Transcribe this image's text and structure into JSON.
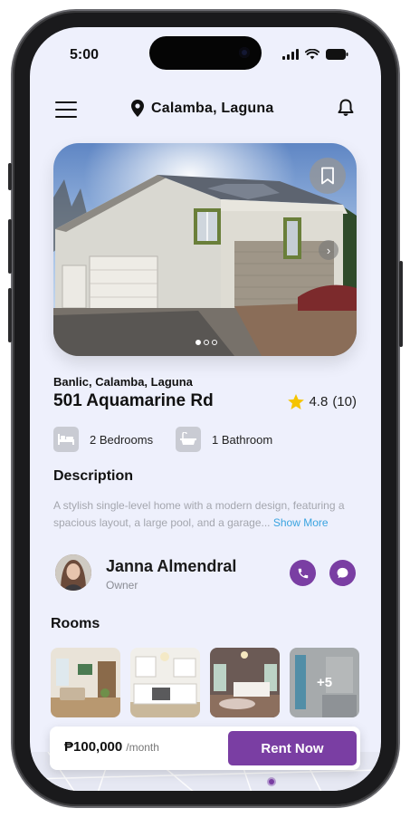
{
  "status_bar": {
    "time": "5:00"
  },
  "header": {
    "location": "Calamba, Laguna",
    "icons": [
      "menu-icon",
      "location-pin-icon",
      "bell-icon"
    ]
  },
  "listing": {
    "gallery": {
      "bookmark_icon": "bookmark-icon",
      "next_icon": "chevron-right-icon",
      "page_count": 3,
      "active_page": 1
    },
    "address_line": "Banlic, Calamba, Laguna",
    "street": "501 Aquamarine Rd",
    "rating": "4.8",
    "review_count": "(10)",
    "features": [
      {
        "icon": "bed-icon",
        "label": "2 Bedrooms"
      },
      {
        "icon": "bathtub-icon",
        "label": "1 Bathroom"
      }
    ]
  },
  "description": {
    "heading": "Description",
    "text": "A stylish single-level home with a modern design, featuring a spacious layout, a large pool, and a garage...",
    "more_label": "Show More"
  },
  "owner": {
    "name": "Janna Almendral",
    "role": "Owner",
    "call_icon": "phone-icon",
    "chat_icon": "chat-icon"
  },
  "rooms": {
    "heading": "Rooms",
    "more_count": "+5"
  },
  "footer": {
    "price": "₱100,000",
    "period": "/month",
    "cta": "Rent Now"
  },
  "colors": {
    "accent": "#7a3ea3",
    "background": "#eef0fc",
    "link": "#3aa4e0",
    "star": "#f5c400"
  }
}
